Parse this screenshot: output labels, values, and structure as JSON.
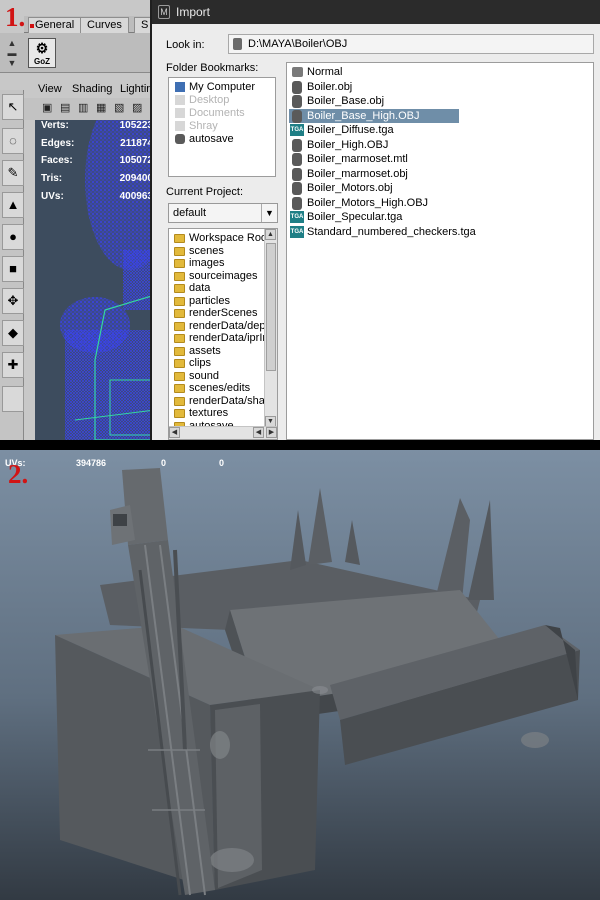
{
  "step_labels": {
    "first": "1.",
    "second": "2."
  },
  "maya": {
    "shelf_tabs": [
      "General",
      "Curves",
      "S"
    ],
    "shelf_button": "GoZ",
    "view_menu": [
      "View",
      "Shading",
      "Lighting"
    ],
    "hud": [
      {
        "label": "Verts:",
        "value": "105223"
      },
      {
        "label": "Edges:",
        "value": "211874"
      },
      {
        "label": "Faces:",
        "value": "105072"
      },
      {
        "label": "Tris:",
        "value": "209400"
      },
      {
        "label": "UVs:",
        "value": "400963"
      }
    ]
  },
  "import_dialog": {
    "title": "Import",
    "look_in_label": "Look in:",
    "look_in_path": "D:\\MAYA\\Boiler\\OBJ",
    "folder_bookmarks_label": "Folder Bookmarks:",
    "bookmarks": [
      {
        "label": "My Computer",
        "enabled": true,
        "icon": "computer-icon"
      },
      {
        "label": "Desktop",
        "enabled": false,
        "icon": "desktop-icon"
      },
      {
        "label": "Documents",
        "enabled": false,
        "icon": "documents-icon"
      },
      {
        "label": "Shray",
        "enabled": false,
        "icon": "user-folder-icon"
      },
      {
        "label": "autosave",
        "enabled": true,
        "icon": "drive-icon"
      }
    ],
    "current_project_label": "Current Project:",
    "current_project": "default",
    "project_folders": [
      "Workspace Root",
      "scenes",
      "images",
      "sourceimages",
      "data",
      "particles",
      "renderScenes",
      "renderData/depth",
      "renderData/iprImages",
      "assets",
      "clips",
      "sound",
      "scenes/edits",
      "renderData/shaders",
      "textures",
      "autosave"
    ],
    "files": [
      {
        "name": "Normal",
        "type": "folder",
        "selected": false
      },
      {
        "name": "Boiler.obj",
        "type": "obj",
        "selected": false
      },
      {
        "name": "Boiler_Base.obj",
        "type": "obj",
        "selected": false
      },
      {
        "name": "Boiler_Base_High.OBJ",
        "type": "obj",
        "selected": true
      },
      {
        "name": "Boiler_Diffuse.tga",
        "type": "tga",
        "selected": false
      },
      {
        "name": "Boiler_High.OBJ",
        "type": "obj",
        "selected": false
      },
      {
        "name": "Boiler_marmoset.mtl",
        "type": "obj",
        "selected": false
      },
      {
        "name": "Boiler_marmoset.obj",
        "type": "obj",
        "selected": false
      },
      {
        "name": "Boiler_Motors.obj",
        "type": "obj",
        "selected": false
      },
      {
        "name": "Boiler_Motors_High.OBJ",
        "type": "obj",
        "selected": false
      },
      {
        "name": "Boiler_Specular.tga",
        "type": "tga",
        "selected": false
      },
      {
        "name": "Standard_numbered_checkers.tga",
        "type": "tga",
        "selected": false
      }
    ],
    "tga_badge": "TGA"
  },
  "render_view": {
    "hud": {
      "label": "UVs:",
      "values": [
        "394786",
        "0",
        "0"
      ]
    }
  },
  "colors": {
    "selection": "#6f8ea8",
    "step_label": "#d11414",
    "wireframe": "#3a43e8",
    "wire_highlight": "#35d6a0"
  }
}
